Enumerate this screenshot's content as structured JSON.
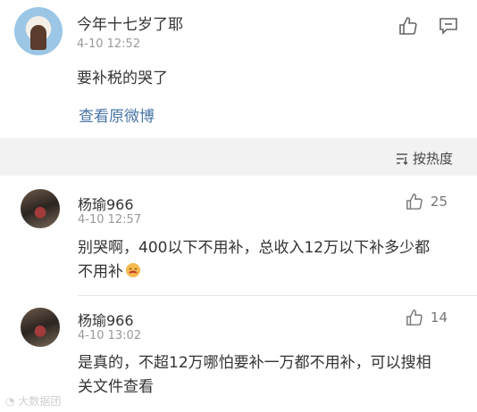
{
  "post": {
    "author": "今年十七岁了耶",
    "time": "4-10 12:52",
    "text": "要补税的哭了",
    "link": "查看原微博"
  },
  "sort": {
    "label": "按热度"
  },
  "comments": [
    {
      "name": "杨瑜966",
      "time": "4-10 12:57",
      "likes": "25",
      "text": "别哭啊，400以下不用补，总收入12万以下补多少都不用补"
    },
    {
      "name": "杨瑜966",
      "time": "4-10 13:02",
      "likes": "14",
      "text": "是真的，不超12万哪怕要补一万都不用补，可以搜相关文件查看"
    }
  ],
  "watermark": "大数据团"
}
